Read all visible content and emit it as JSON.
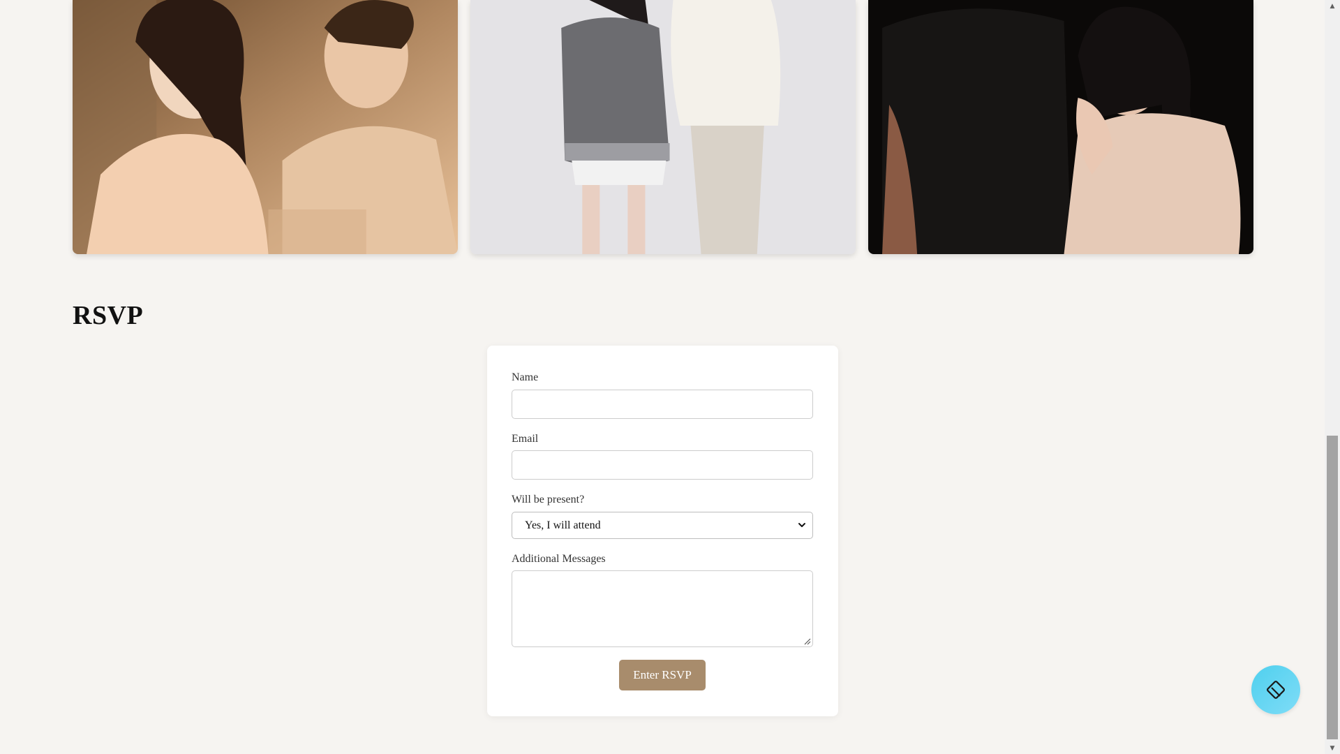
{
  "gallery": {
    "photos": [
      {
        "name": "couple-photo-1"
      },
      {
        "name": "couple-photo-2"
      },
      {
        "name": "couple-photo-3"
      }
    ]
  },
  "rsvp": {
    "title": "RSVP",
    "name_label": "Name",
    "name_value": "",
    "email_label": "Email",
    "email_value": "",
    "attendance_label": "Will be present?",
    "attendance_selected": "Yes, I will attend",
    "messages_label": "Additional Messages",
    "messages_value": "",
    "submit_label": "Enter RSVP"
  },
  "colors": {
    "page_bg": "#f6f4f1",
    "button_bg": "#a88c6c",
    "fab_bg": "#5fd4f0"
  },
  "icons": {
    "fab": "diamond-layers-icon",
    "select_arrow": "chevron-down-icon",
    "scroll_up": "arrow-up-icon",
    "scroll_down": "arrow-down-icon"
  }
}
